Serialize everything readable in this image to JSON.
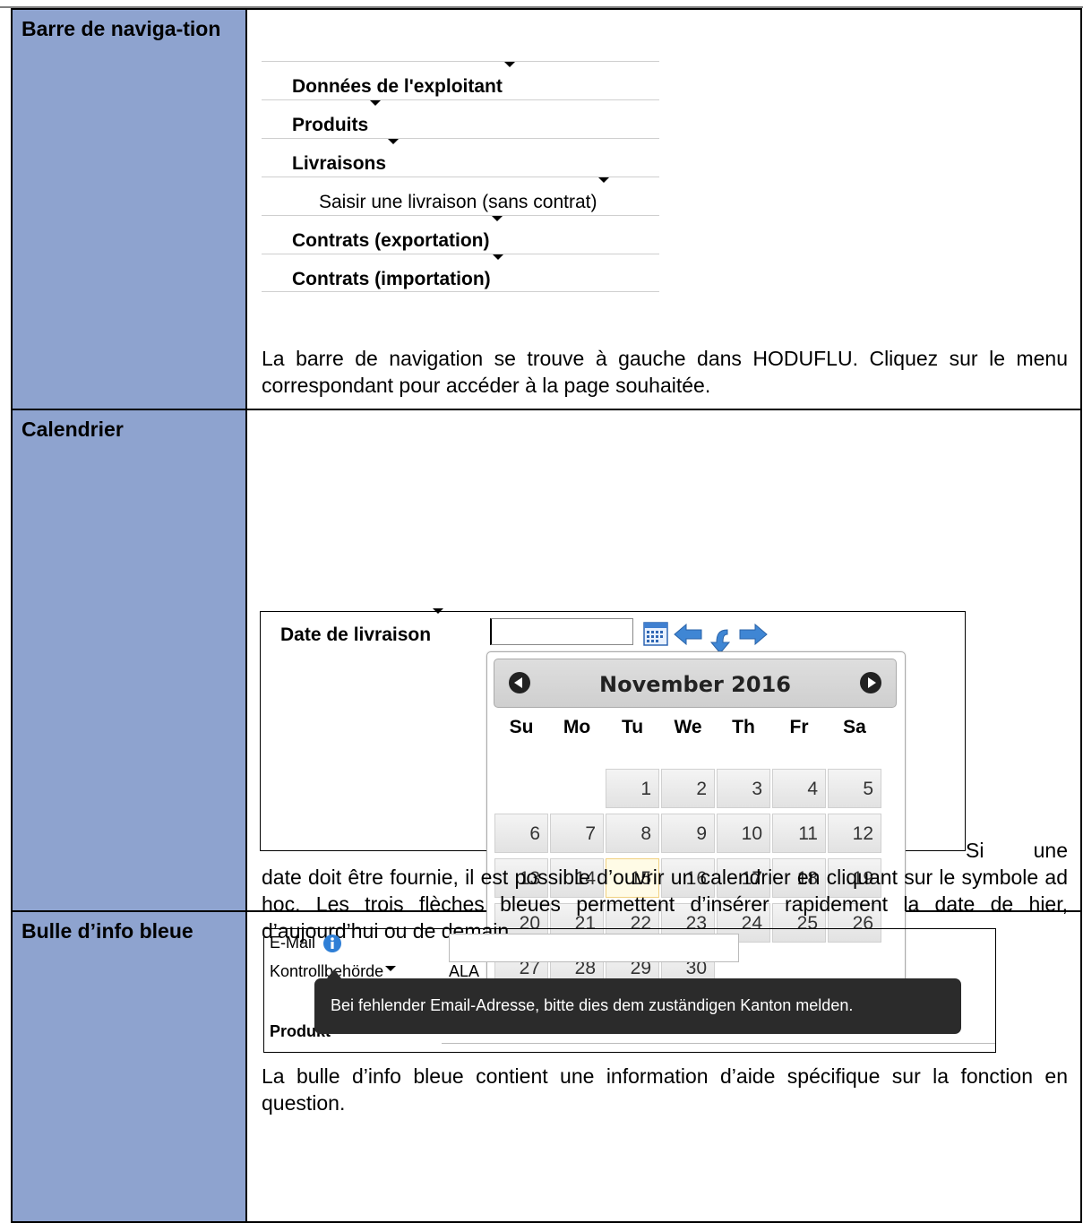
{
  "sections": [
    {
      "label": "Barre de naviga-tion",
      "nav_items": [
        {
          "text": "Données de l'exploitant",
          "style": "bold"
        },
        {
          "text": "Produits",
          "style": "bold"
        },
        {
          "text": "Livraisons",
          "style": "bold"
        },
        {
          "text": "Saisir une livraison (sans contrat)",
          "style": "sub"
        },
        {
          "text": "Contrats (exportation)",
          "style": "bold"
        },
        {
          "text": "Contrats (importation)",
          "style": "bold"
        }
      ],
      "description": "La barre de navigation se trouve à gauche dans HODUFLU. Cliquez sur le menu correspondant pour accéder à la page souhaitée."
    },
    {
      "label": "Calendrier",
      "date_label": "Date de livraison",
      "date_value": "",
      "calendar": {
        "month_year": "November 2016",
        "weekdays": [
          "Su",
          "Mo",
          "Tu",
          "We",
          "Th",
          "Fr",
          "Sa"
        ],
        "first_weekday_index": 2,
        "days": [
          "1",
          "2",
          "3",
          "4",
          "5",
          "6",
          "7",
          "8",
          "9",
          "10",
          "11",
          "12",
          "13",
          "14",
          "15",
          "16",
          "17",
          "18",
          "19",
          "20",
          "21",
          "22",
          "23",
          "24",
          "25",
          "26",
          "27",
          "28",
          "29",
          "30"
        ],
        "highlighted_day": "15"
      },
      "description": "Si une date doit être fournie, il est possible d’ouvrir un calendrier en cliquant sur le symbole ad hoc. Les trois flèches bleues permettent d’insérer rapidement la date de hier, d’aujourd’hui ou de demain.",
      "icons": [
        "calendar-icon",
        "arrow-left-icon",
        "arrow-down-icon",
        "arrow-right-icon"
      ],
      "colors": {
        "arrow_blue": "#3f86d4"
      }
    },
    {
      "label": "Bulle d’info bleue",
      "email_label": "E-Mail",
      "authority_label": "Kontrollbehörde",
      "authority_value": "ALA",
      "tooltip": "Bei fehlender Email-Adresse, bitte dies dem zuständigen Kanton melden.",
      "product_label": "Produkt",
      "description": "La bulle d’info bleue contient une information d’aide spécifique sur la fonction en question.",
      "colors": {
        "info_blue": "#2f7fd6",
        "tooltip_bg": "#2b2b2b"
      }
    }
  ],
  "colors": {
    "label_cell_bg": "#8ea3cf"
  }
}
